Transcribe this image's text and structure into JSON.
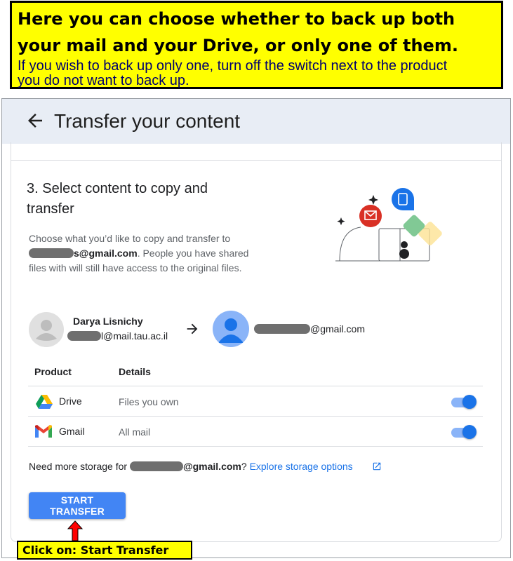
{
  "callout_top": {
    "line1": "Here you can choose whether to back up both",
    "line2": "your mail and your Drive, or only one of them.",
    "line3": "If you wish to back up only one, turn off the switch next to the product",
    "line4": "you do not want to back up."
  },
  "header": {
    "back_icon": "arrow-left-icon",
    "title": "Transfer your content"
  },
  "step": {
    "title": "3. Select content to copy and transfer",
    "desc_prefix": "Choose what you’d like to copy and transfer to",
    "desc_email": "s@gmail.com",
    "desc_suffix": ". People you have shared files with will still have access to the original files."
  },
  "source": {
    "name": "Darya Lisnichy",
    "email": "l@mail.tau.ac.il"
  },
  "destination": {
    "email": "@gmail.com"
  },
  "table": {
    "headers": [
      "Product",
      "Details"
    ],
    "rows": [
      {
        "product": "Drive",
        "details": "Files you own",
        "icon": "google-drive-icon",
        "enabled": true
      },
      {
        "product": "Gmail",
        "details": "All mail",
        "icon": "gmail-icon",
        "enabled": true
      }
    ]
  },
  "storage": {
    "prefix": "Need more storage for",
    "email": "@gmail.com",
    "question": "?",
    "link": "Explore storage options",
    "link_icon": "open-in-new-icon"
  },
  "actions": {
    "start_transfer": "START TRANSFER"
  },
  "callout_bottom": {
    "text": "Click on: Start Transfer"
  },
  "colors": {
    "accent": "#1a73e8",
    "button": "#4285f4",
    "callout": "#ffff00",
    "header_bg": "#e8edf5"
  }
}
